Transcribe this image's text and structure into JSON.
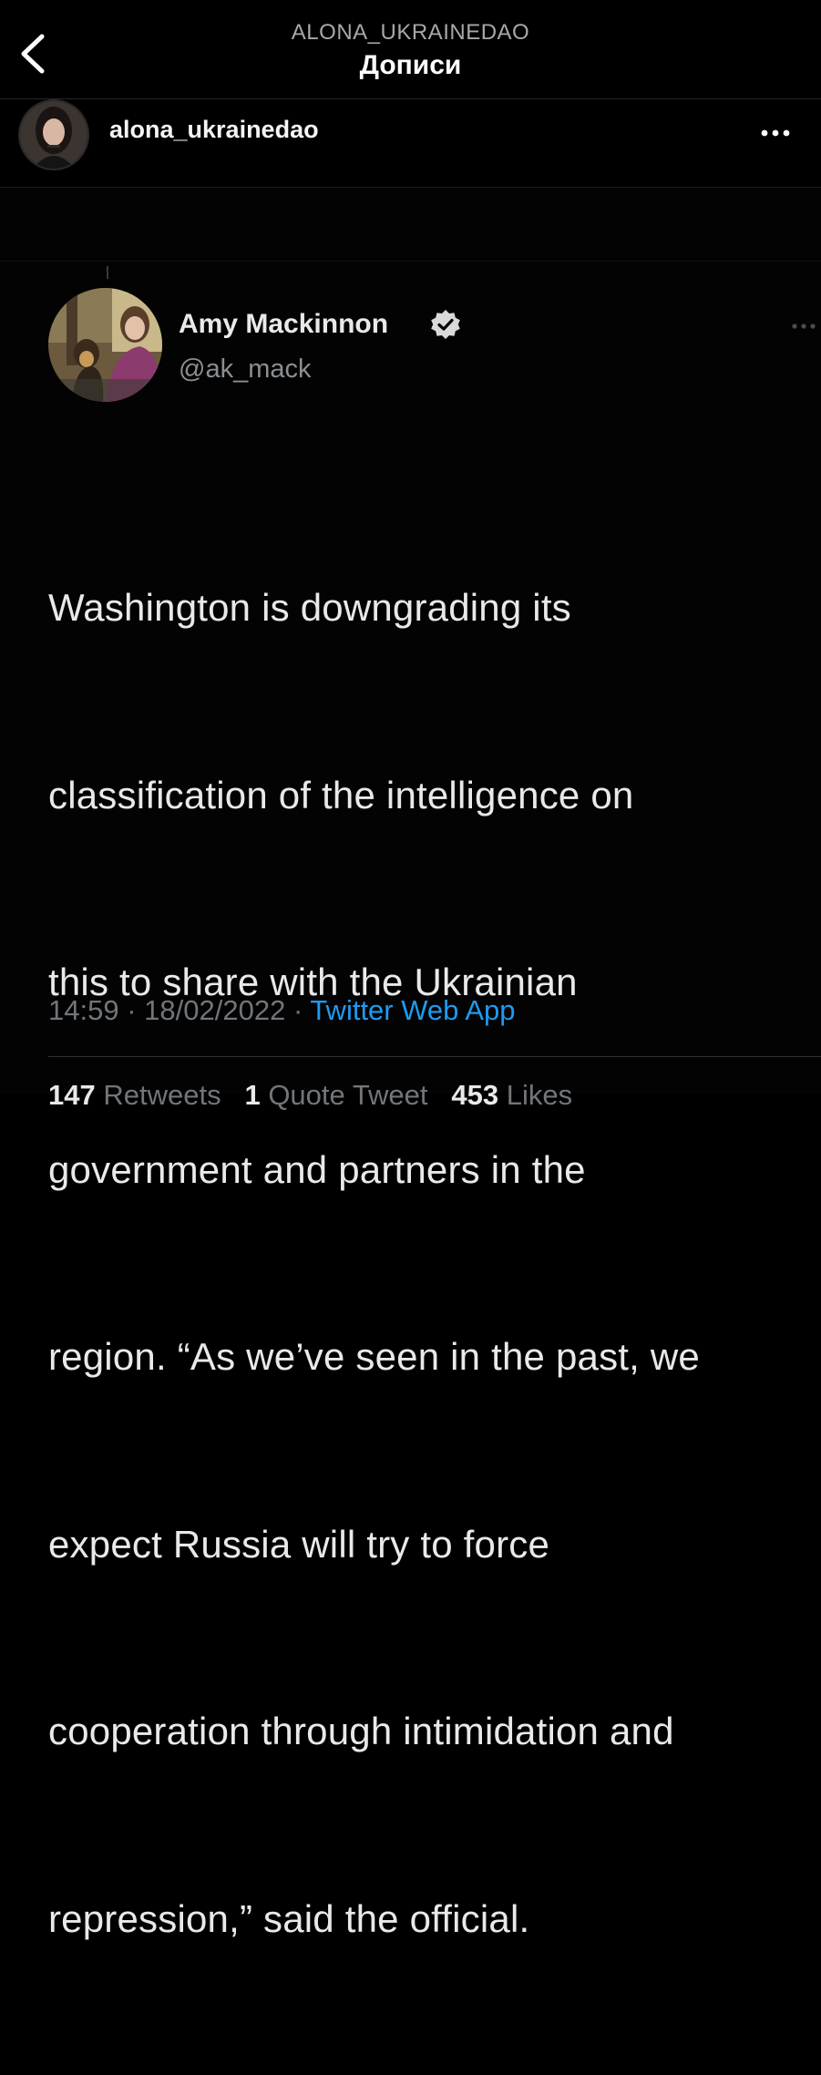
{
  "header": {
    "username": "ALONA_UKRAINEDAO",
    "title": "Дописи",
    "back_icon": "chevron-left-icon"
  },
  "post": {
    "owner_username": "alona_ukrainedao",
    "more_icon": "more-horizontal-icon"
  },
  "tweet": {
    "author_name": "Amy Mackinnon",
    "handle": "@ak_mack",
    "verified_icon": "verified-badge-icon",
    "text_lines": [
      "Washington is downgrading its",
      "classification of the intelligence on",
      "this to share with the Ukrainian",
      "government and partners in the",
      "region. “As we’ve seen in the past, we",
      "expect Russia will try to force",
      "cooperation through intimidation and",
      "repression,” said the official."
    ],
    "time": "14:59",
    "date": "18/02/2022",
    "separator": "·",
    "source": "Twitter Web App",
    "retweets_count": "147",
    "retweets_label": "Retweets",
    "quotes_count": "1",
    "quotes_label": "Quote Tweet",
    "likes_count": "453",
    "likes_label": "Likes"
  },
  "colors": {
    "background": "#000000",
    "link_blue": "#1d9bf0",
    "verified_gray": "#d9d9d9",
    "muted_text": "#71767b"
  }
}
